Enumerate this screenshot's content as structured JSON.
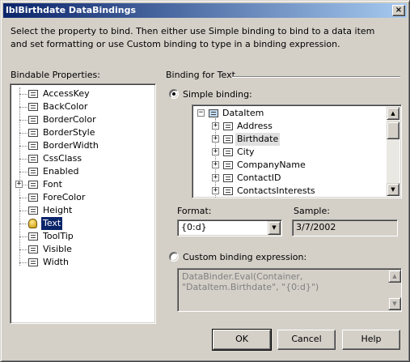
{
  "window": {
    "title": "lblBirthdate DataBindings",
    "close_label": "×"
  },
  "instructions": "Select the property to bind. Then either use Simple binding to bind to a data item and set formatting or use Custom binding to type in a binding expression.",
  "bindable": {
    "label": "Bindable Properties:",
    "items": [
      {
        "label": "AccessKey",
        "expandable": false,
        "bound": false,
        "selected": false
      },
      {
        "label": "BackColor",
        "expandable": false,
        "bound": false,
        "selected": false
      },
      {
        "label": "BorderColor",
        "expandable": false,
        "bound": false,
        "selected": false
      },
      {
        "label": "BorderStyle",
        "expandable": false,
        "bound": false,
        "selected": false
      },
      {
        "label": "BorderWidth",
        "expandable": false,
        "bound": false,
        "selected": false
      },
      {
        "label": "CssClass",
        "expandable": false,
        "bound": false,
        "selected": false
      },
      {
        "label": "Enabled",
        "expandable": false,
        "bound": false,
        "selected": false
      },
      {
        "label": "Font",
        "expandable": true,
        "bound": false,
        "selected": false
      },
      {
        "label": "ForeColor",
        "expandable": false,
        "bound": false,
        "selected": false
      },
      {
        "label": "Height",
        "expandable": false,
        "bound": false,
        "selected": false
      },
      {
        "label": "Text",
        "expandable": false,
        "bound": true,
        "selected": true
      },
      {
        "label": "ToolTip",
        "expandable": false,
        "bound": false,
        "selected": false
      },
      {
        "label": "Visible",
        "expandable": false,
        "bound": false,
        "selected": false
      },
      {
        "label": "Width",
        "expandable": false,
        "bound": false,
        "selected": false
      }
    ]
  },
  "binding": {
    "group_label": "Binding for Text",
    "simple_label": "Simple binding:",
    "simple_checked": true,
    "tree": {
      "root": "DataItem",
      "children": [
        "Address",
        "Birthdate",
        "City",
        "CompanyName",
        "ContactID",
        "ContactsInterests"
      ],
      "highlighted": "Birthdate"
    },
    "format_label": "Format:",
    "format_value": "{0:d}",
    "sample_label": "Sample:",
    "sample_value": "3/7/2002",
    "custom_label": "Custom binding expression:",
    "custom_checked": false,
    "custom_expression": "DataBinder.Eval(Container, \"DataItem.Birthdate\", \"{0:d}\")"
  },
  "buttons": {
    "ok": "OK",
    "cancel": "Cancel",
    "help": "Help"
  },
  "colors": {
    "title_start": "#0a246a",
    "title_end": "#a6caf0",
    "face": "#d4d0c8",
    "selection": "#0a246a"
  }
}
